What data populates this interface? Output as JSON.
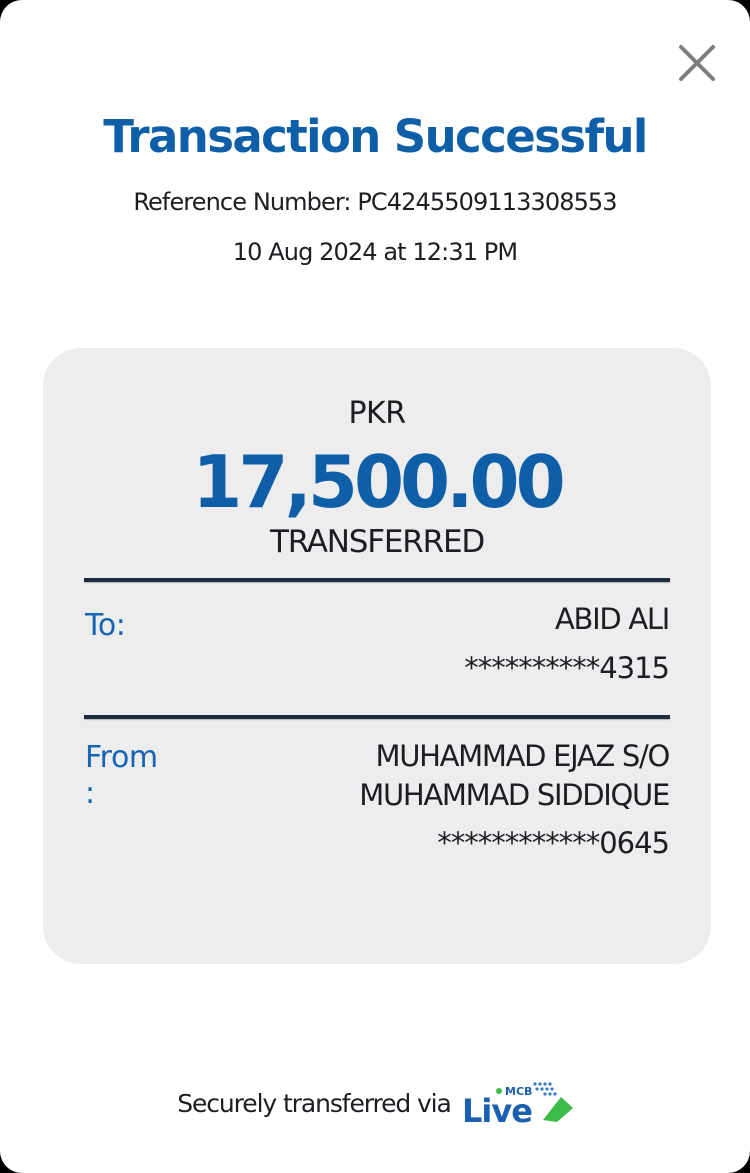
{
  "dialog": {
    "title": "Transaction Successful",
    "reference_label": "Reference Number:",
    "reference_number": "PC4245509113308553",
    "datetime": "10 Aug 2024 at 12:31 PM"
  },
  "receipt": {
    "currency": "PKR",
    "amount": "17,500.00",
    "status": "TRANSFERRED",
    "to": {
      "label": "To:",
      "name": "ABID ALI",
      "account": "**********4315"
    },
    "from": {
      "label_line1": "From",
      "label_line2": ":",
      "name_line1": "MUHAMMAD EJAZ S/O",
      "name_line2": "MUHAMMAD SIDDIQUE",
      "account": "************0645"
    }
  },
  "footer": {
    "text": "Securely transferred via",
    "logo_small": "MCB",
    "logo_main": "Live"
  },
  "colors": {
    "accent_blue": "#0f5fa8",
    "label_blue": "#1565b3",
    "card_bg": "#ededed",
    "logo_green": "#3dbb4a"
  },
  "icons": {
    "close": "close-icon",
    "logo": "mcb-live-logo"
  }
}
